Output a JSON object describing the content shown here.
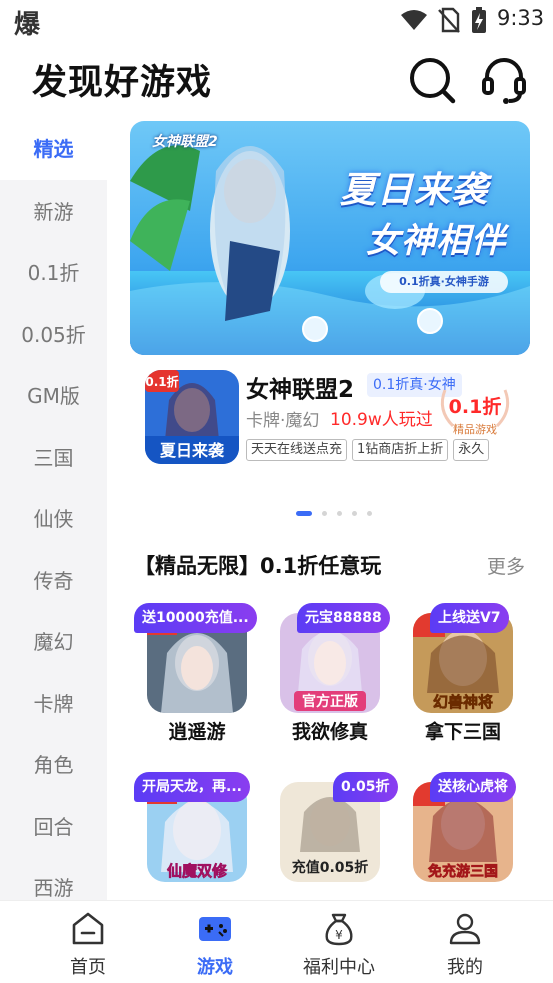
{
  "status_bar": {
    "app_glyph": "爆",
    "time": "9:33"
  },
  "header": {
    "title": "发现好游戏"
  },
  "sidebar": {
    "items": [
      {
        "label": "精选",
        "active": true
      },
      {
        "label": "新游"
      },
      {
        "label": "0.1折"
      },
      {
        "label": "0.05折"
      },
      {
        "label": "GM版"
      },
      {
        "label": "三国"
      },
      {
        "label": "仙侠"
      },
      {
        "label": "传奇"
      },
      {
        "label": "魔幻"
      },
      {
        "label": "卡牌"
      },
      {
        "label": "角色"
      },
      {
        "label": "回合"
      },
      {
        "label": "西游"
      }
    ]
  },
  "banner": {
    "logo": "女神联盟2",
    "headline_1": "夏日来袭",
    "headline_2": "女神相伴",
    "subline": "0.1折真·女神手游"
  },
  "featured": {
    "icon_caption": "夏日来袭",
    "icon_badge": "0.1折",
    "name": "女神联盟2",
    "tag": "0.1折真·女神",
    "genre": "卡牌·魔幻",
    "players": "10.9w人玩过",
    "discount": "0.1折",
    "discount_note": "精品游戏",
    "chips": [
      "天天在线送点充",
      "1钻商店折上折",
      "永久"
    ]
  },
  "carousel": {
    "count": 5,
    "active": 0
  },
  "section": {
    "title": "【精品无限】0.1折任意玩",
    "more": "更多"
  },
  "games": [
    {
      "name": "逍遥游",
      "badge": "送10000充值...",
      "icon_text": ""
    },
    {
      "name": "我欲修真",
      "badge": "元宝88888",
      "icon_text": "官方正版"
    },
    {
      "name": "拿下三国",
      "badge": "上线送V7",
      "icon_text": "幻兽神将"
    },
    {
      "name": "",
      "badge": "开局天龙，再...",
      "icon_text": "仙魔双修"
    },
    {
      "name": "",
      "badge": "0.05折",
      "icon_text": "充值0.05折"
    },
    {
      "name": "",
      "badge": "送核心虎将",
      "icon_text": "免充游三国"
    }
  ],
  "bottom_nav": [
    {
      "label": "首页",
      "icon": "home-icon"
    },
    {
      "label": "游戏",
      "icon": "gamepad-icon",
      "active": true
    },
    {
      "label": "福利中心",
      "icon": "money-bag-icon"
    },
    {
      "label": "我的",
      "icon": "profile-icon"
    }
  ],
  "colors": {
    "accent": "#3b6cf6",
    "price_red": "#ff2a2a",
    "badge_purple": "#6a3cf3"
  }
}
